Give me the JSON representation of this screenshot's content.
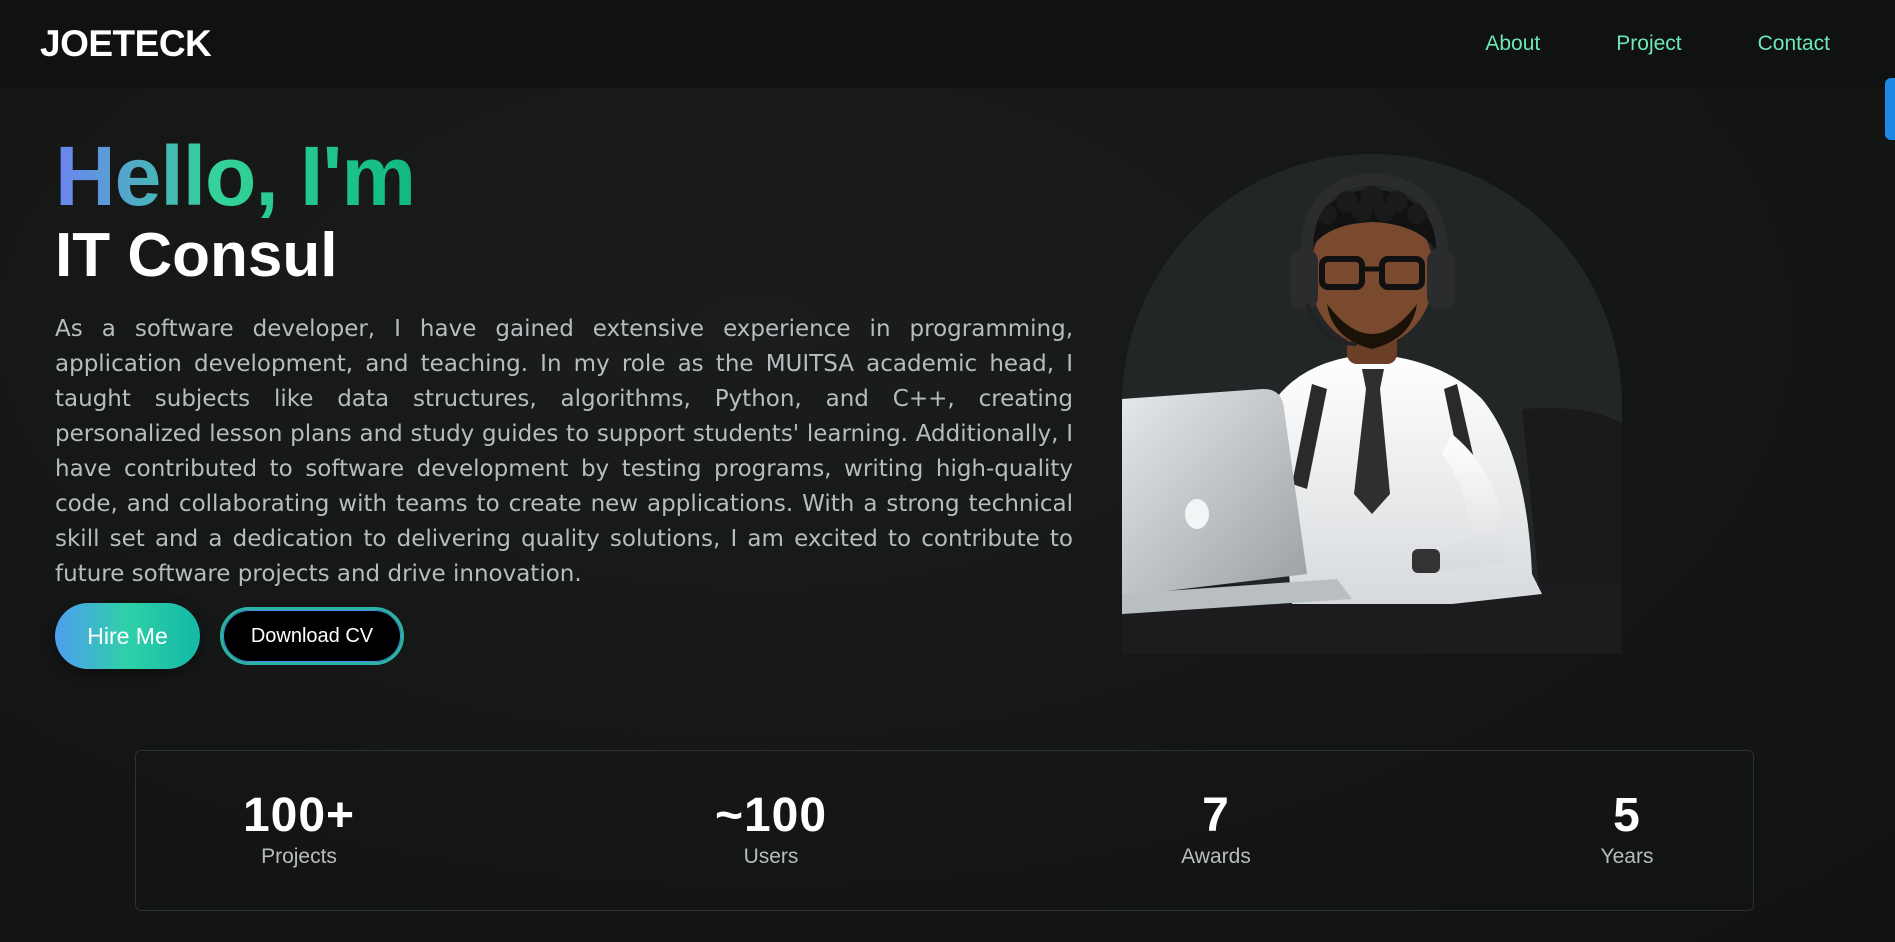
{
  "brand": "JOETECK",
  "nav": {
    "about": "About",
    "project": "Project",
    "contact": "Contact"
  },
  "hero": {
    "greeting": "Hello, I'm",
    "role": "IT Consul",
    "bio": "As a software developer, I have gained extensive experience in programming, application development, and teaching. In my role as the MUITSA academic head, I taught subjects like data structures, algorithms, Python, and C++, creating personalized lesson plans and study guides to support students' learning. Additionally, I have contributed to software development by testing programs, writing high-quality code, and collaborating with teams to create new applications. With a strong technical skill set and a dedication to delivering quality solutions, I am excited to contribute to future software projects and drive innovation.",
    "hire_label": "Hire Me",
    "cv_label": "Download CV"
  },
  "stats": [
    {
      "value": "100+",
      "label": "Projects"
    },
    {
      "value": "~100",
      "label": "Users"
    },
    {
      "value": "7",
      "label": "Awards"
    },
    {
      "value": "5",
      "label": "Years"
    }
  ],
  "colors": {
    "accent_green": "#6ee7b7",
    "gradient_start": "#6d83f2",
    "gradient_end": "#10b981",
    "scroll_indicator": "#1e88e5"
  }
}
